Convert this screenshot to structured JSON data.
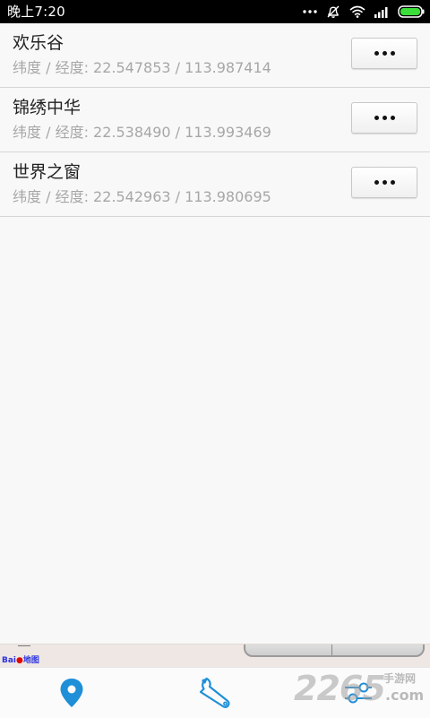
{
  "status_bar": {
    "time": "晚上7:20",
    "icons": [
      "more-dots-icon",
      "alarm-off-icon",
      "wifi-icon",
      "signal-icon",
      "battery-icon"
    ]
  },
  "locations": [
    {
      "name": "欢乐谷",
      "coords": "纬度 / 经度: 22.547853 / 113.987414"
    },
    {
      "name": "锦绣中华",
      "coords": "纬度 / 经度: 22.538490 / 113.993469"
    },
    {
      "name": "世界之窗",
      "coords": "纬度 / 经度: 22.542963 / 113.980695"
    }
  ],
  "ad": {
    "logo_text": "Bai",
    "logo_suffix": "地图"
  },
  "bottom_nav": {
    "tabs": [
      {
        "icon": "location-pin-icon",
        "active": true
      },
      {
        "icon": "wrench-icon",
        "active": false
      },
      {
        "icon": "settings-sliders-icon",
        "active": false
      }
    ]
  },
  "watermark": {
    "digits": "2265",
    "line1": "手游网",
    ".com": ".com",
    "line2": ".com"
  },
  "colors": {
    "accent": "#1f8fd8",
    "background": "#f8f8f8",
    "secondary_text": "#a7a7a7"
  }
}
